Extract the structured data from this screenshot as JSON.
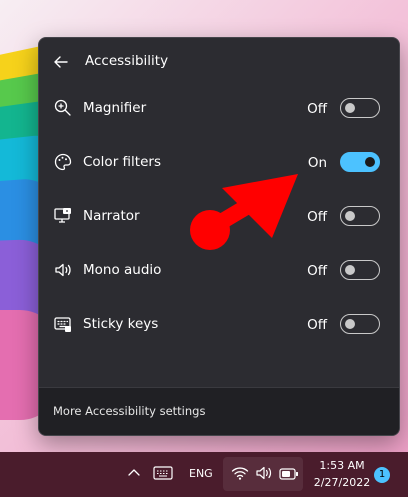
{
  "panel": {
    "title": "Accessibility",
    "footer_link": "More Accessibility settings",
    "items": [
      {
        "label": "Magnifier",
        "state": "Off",
        "on": false,
        "icon": "magnifier-icon"
      },
      {
        "label": "Color filters",
        "state": "On",
        "on": true,
        "icon": "color-filters-icon"
      },
      {
        "label": "Narrator",
        "state": "Off",
        "on": false,
        "icon": "narrator-icon"
      },
      {
        "label": "Mono audio",
        "state": "Off",
        "on": false,
        "icon": "mono-audio-icon"
      },
      {
        "label": "Sticky keys",
        "state": "Off",
        "on": false,
        "icon": "sticky-keys-icon"
      }
    ]
  },
  "taskbar": {
    "language": "ENG",
    "time": "1:53 AM",
    "date": "2/27/2022",
    "notification_count": "1"
  },
  "colors": {
    "accent": "#4cc2ff",
    "panel_bg": "#2c2c31",
    "taskbar_bg": "#4a1c2c",
    "annotation_arrow": "#ff0000"
  }
}
